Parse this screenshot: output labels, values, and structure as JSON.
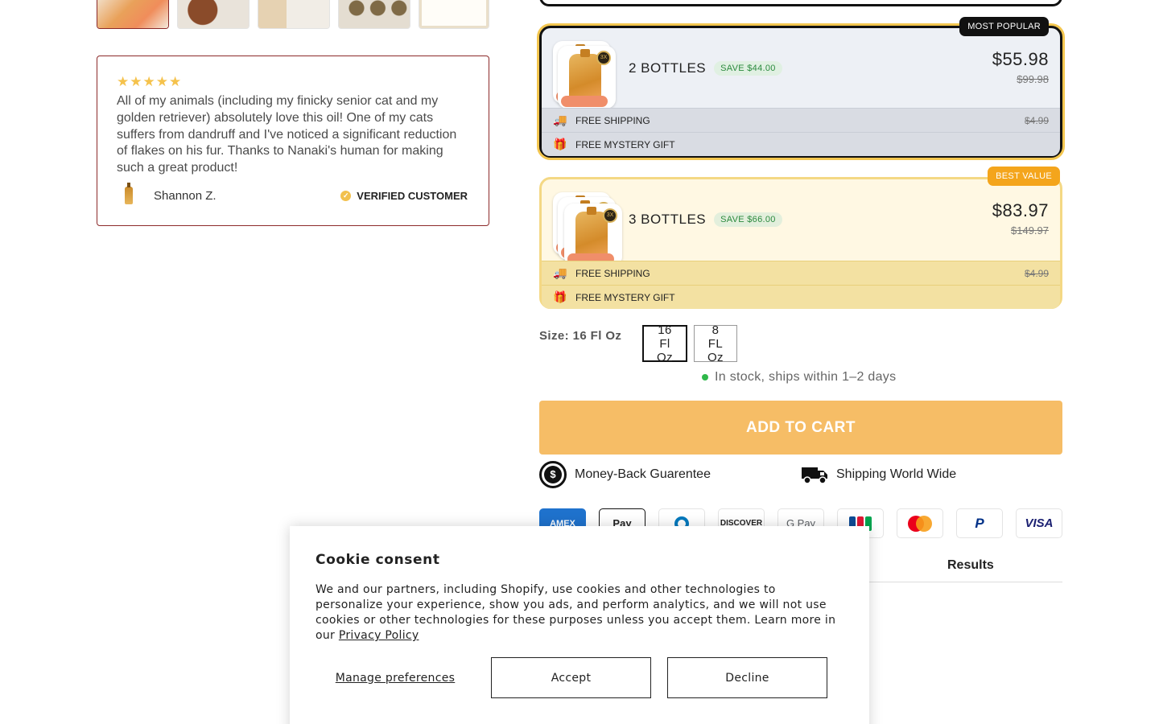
{
  "thumbnails": [
    {
      "label": "",
      "active": true
    },
    {
      "label": "",
      "active": false
    },
    {
      "label": "",
      "active": false
    },
    {
      "label": "",
      "active": false
    },
    {
      "label": "",
      "active": false
    }
  ],
  "review": {
    "stars": "★★★★★",
    "rating": 5,
    "text": "All of my animals (including my finicky senior cat and my golden retriever) absolutely love this oil! One of my cats suffers from dandruff and I've noticed a significant reduction of flakes on his fur. Thanks to Nanaki's human for making such a great product!",
    "author": "Shannon Z.",
    "verified_label": "VERIFIED CUSTOMER"
  },
  "bundles": {
    "two": {
      "badge": "MOST POPULAR",
      "qty_label": "2 BOTTLES",
      "save_label": "SAVE $44.00",
      "price": "$55.98",
      "old_price": "$99.98",
      "shipping_label": "FREE SHIPPING",
      "shipping_old": "$4.99",
      "gift_label": "FREE MYSTERY GIFT"
    },
    "three": {
      "badge": "BEST VALUE",
      "qty_label": "3 BOTTLES",
      "save_label": "SAVE $66.00",
      "price": "$83.97",
      "old_price": "$149.97",
      "shipping_label": "FREE SHIPPING",
      "shipping_old": "$4.99",
      "gift_label": "FREE MYSTERY GIFT"
    }
  },
  "size": {
    "label": "Size: 16 Fl Oz",
    "options": [
      "16 Fl Oz",
      "8 FL Oz"
    ],
    "selected": "16 Fl Oz"
  },
  "stock_text": "In stock, ships within 1–2 days",
  "add_to_cart": "ADD TO CART",
  "guarantees": {
    "money_back": "Money-Back Guarentee",
    "shipping": "Shipping World Wide"
  },
  "payments": [
    "AMEX",
    "Apple Pay",
    "Diners",
    "DISCOVER",
    "G Pay",
    "JCB",
    "Mastercard",
    "PayPal",
    "VISA"
  ],
  "tabs": {
    "results": "Results"
  },
  "cookie": {
    "title": "Cookie consent",
    "text": "We and our partners, including Shopify, use cookies and other technologies to personalize your experience, show you ads, and perform analytics, and we will not use cookies or other technologies for these purposes unless you accept them. Learn more in our ",
    "privacy_link": "Privacy Policy",
    "manage": "Manage preferences",
    "accept": "Accept",
    "decline": "Decline"
  },
  "colors": {
    "accent_border": "#8c2a2a",
    "gold": "#f3c64f",
    "cart_button": "#f6bd66",
    "save_green": "#2b8a3e",
    "best_value": "#f4a51c"
  }
}
